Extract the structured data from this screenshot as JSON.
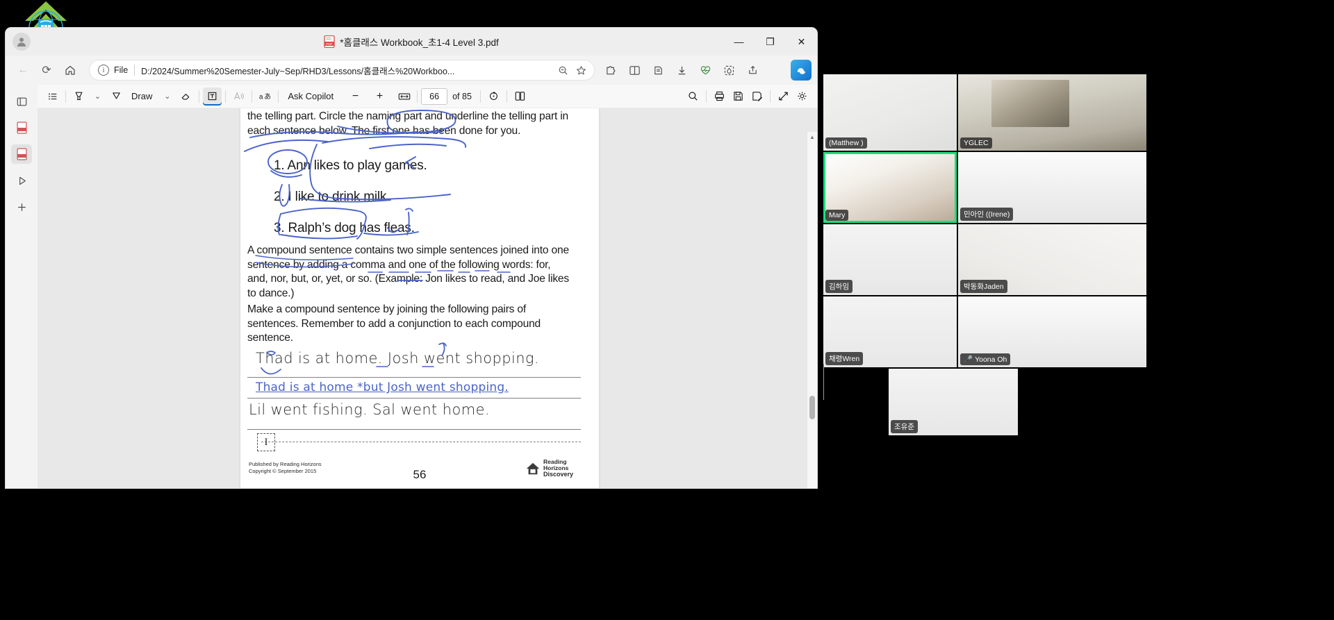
{
  "window": {
    "tab_title": "*홈클래스 Workbook_초1-4 Level 3.pdf",
    "minimize_label": "—",
    "maximize_label": "❐",
    "close_label": "✕"
  },
  "nav": {
    "back_label": "←",
    "refresh_label": "⟳",
    "home_label": "⌂",
    "file_scheme": "File",
    "url": "D:/2024/Summer%20Semester-July~Sep/RHD3/Lessons/홈클래스%20Workboo...",
    "zoom_out_icon": "magnifier-minus-icon",
    "favorite_icon": "star-icon",
    "extensions_icon": "puzzle-icon",
    "split_icon": "split-screen-icon",
    "collections_icon": "collections-icon",
    "downloads_icon": "download-icon",
    "browser_essentials_icon": "heart-monitor-icon",
    "drop_icon": "drop-icon",
    "share_icon": "share-icon",
    "settings_more_icon": "ellipsis-icon",
    "copilot_icon": "copilot-icon"
  },
  "rail": {
    "items": [
      {
        "name": "sidebar-toggle",
        "icon": "panel-icon"
      },
      {
        "name": "rail-item-pdf-1",
        "icon": "pdf-file-icon"
      },
      {
        "name": "rail-item-pdf-2",
        "icon": "pdf-file-icon"
      },
      {
        "name": "rail-item-play",
        "icon": "play-icon"
      },
      {
        "name": "rail-item-add",
        "icon": "plus-icon"
      }
    ]
  },
  "pdf_toolbar": {
    "toc_icon": "table-of-contents-icon",
    "highlight_icon": "highlighter-icon",
    "highlight_caret": "⌄",
    "draw_icon": "pen-icon",
    "draw_label": "Draw",
    "draw_caret": "⌄",
    "erase_icon": "eraser-icon",
    "text_icon": "add-text-icon",
    "read_aloud_icon": "read-aloud-icon",
    "translate_icon": "translate-icon",
    "ask_copilot_label": "Ask Copilot",
    "zoom_out_label": "−",
    "zoom_in_label": "+",
    "fit_page_icon": "fit-width-icon",
    "page_number": "66",
    "of_pages": "of 85",
    "rotate_icon": "rotate-icon",
    "layout_icon": "page-layout-icon",
    "search_icon": "search-icon",
    "print_icon": "print-icon",
    "save_icon": "save-icon",
    "save_as_icon": "save-as-icon",
    "fullscreen_icon": "fullscreen-icon",
    "settings_icon": "gear-icon"
  },
  "document": {
    "intro_paragraph": "the telling part. Circle the naming part and underline the telling part in each sentence below. The first one has been done for you.",
    "numbered_sentences": [
      "1. Ann likes to play games.",
      "2. I like to drink milk.",
      "3. Ralph’s dog has fleas."
    ],
    "body_paragraph_1": "A compound sentence contains two simple sentences joined into one sentence by adding a comma and one of the following words: for, and, nor, but, or, yet, or so. (Example: Jon likes to read, and Joe likes to dance.)",
    "body_paragraph_2": "Make a compound sentence by joining the following pairs of sentences. Remember to add a conjunction to each compound sentence.",
    "handwriting_prompt_1": "Thad is at home. Josh went shopping.",
    "student_answer_1": "Thad is at home *but Josh went shopping.",
    "handwriting_prompt_2": "Lil went fishing. Sal went home.",
    "cursor_glyph": "I",
    "publisher_line_1": "Published by Reading Horizons",
    "publisher_line_2": "Copyright © September 2015",
    "page_label": "56",
    "logo_line_1": "Reading",
    "logo_line_2": "Horizons",
    "logo_line_3": "Discovery"
  },
  "video_panel": {
    "participants": [
      {
        "name": "(Matthew )",
        "muted": false,
        "active": false
      },
      {
        "name": "YGLEC",
        "muted": false,
        "active": false
      },
      {
        "name": "Mary",
        "muted": false,
        "active": true
      },
      {
        "name": "민아인 ((Irene)",
        "muted": false,
        "active": false
      },
      {
        "name": "김하임",
        "muted": false,
        "active": false
      },
      {
        "name": "박동화Jaden",
        "muted": false,
        "active": false
      },
      {
        "name": "채령Wren",
        "muted": false,
        "active": false
      },
      {
        "name": "Yoona Oh",
        "muted": true,
        "active": false
      },
      {
        "name": "조유준",
        "muted": false,
        "active": false
      }
    ]
  },
  "colors": {
    "ink_blue": "#4a63c8",
    "active_speaker_green": "#19e07c",
    "accent_blue": "#0f6cbd"
  }
}
